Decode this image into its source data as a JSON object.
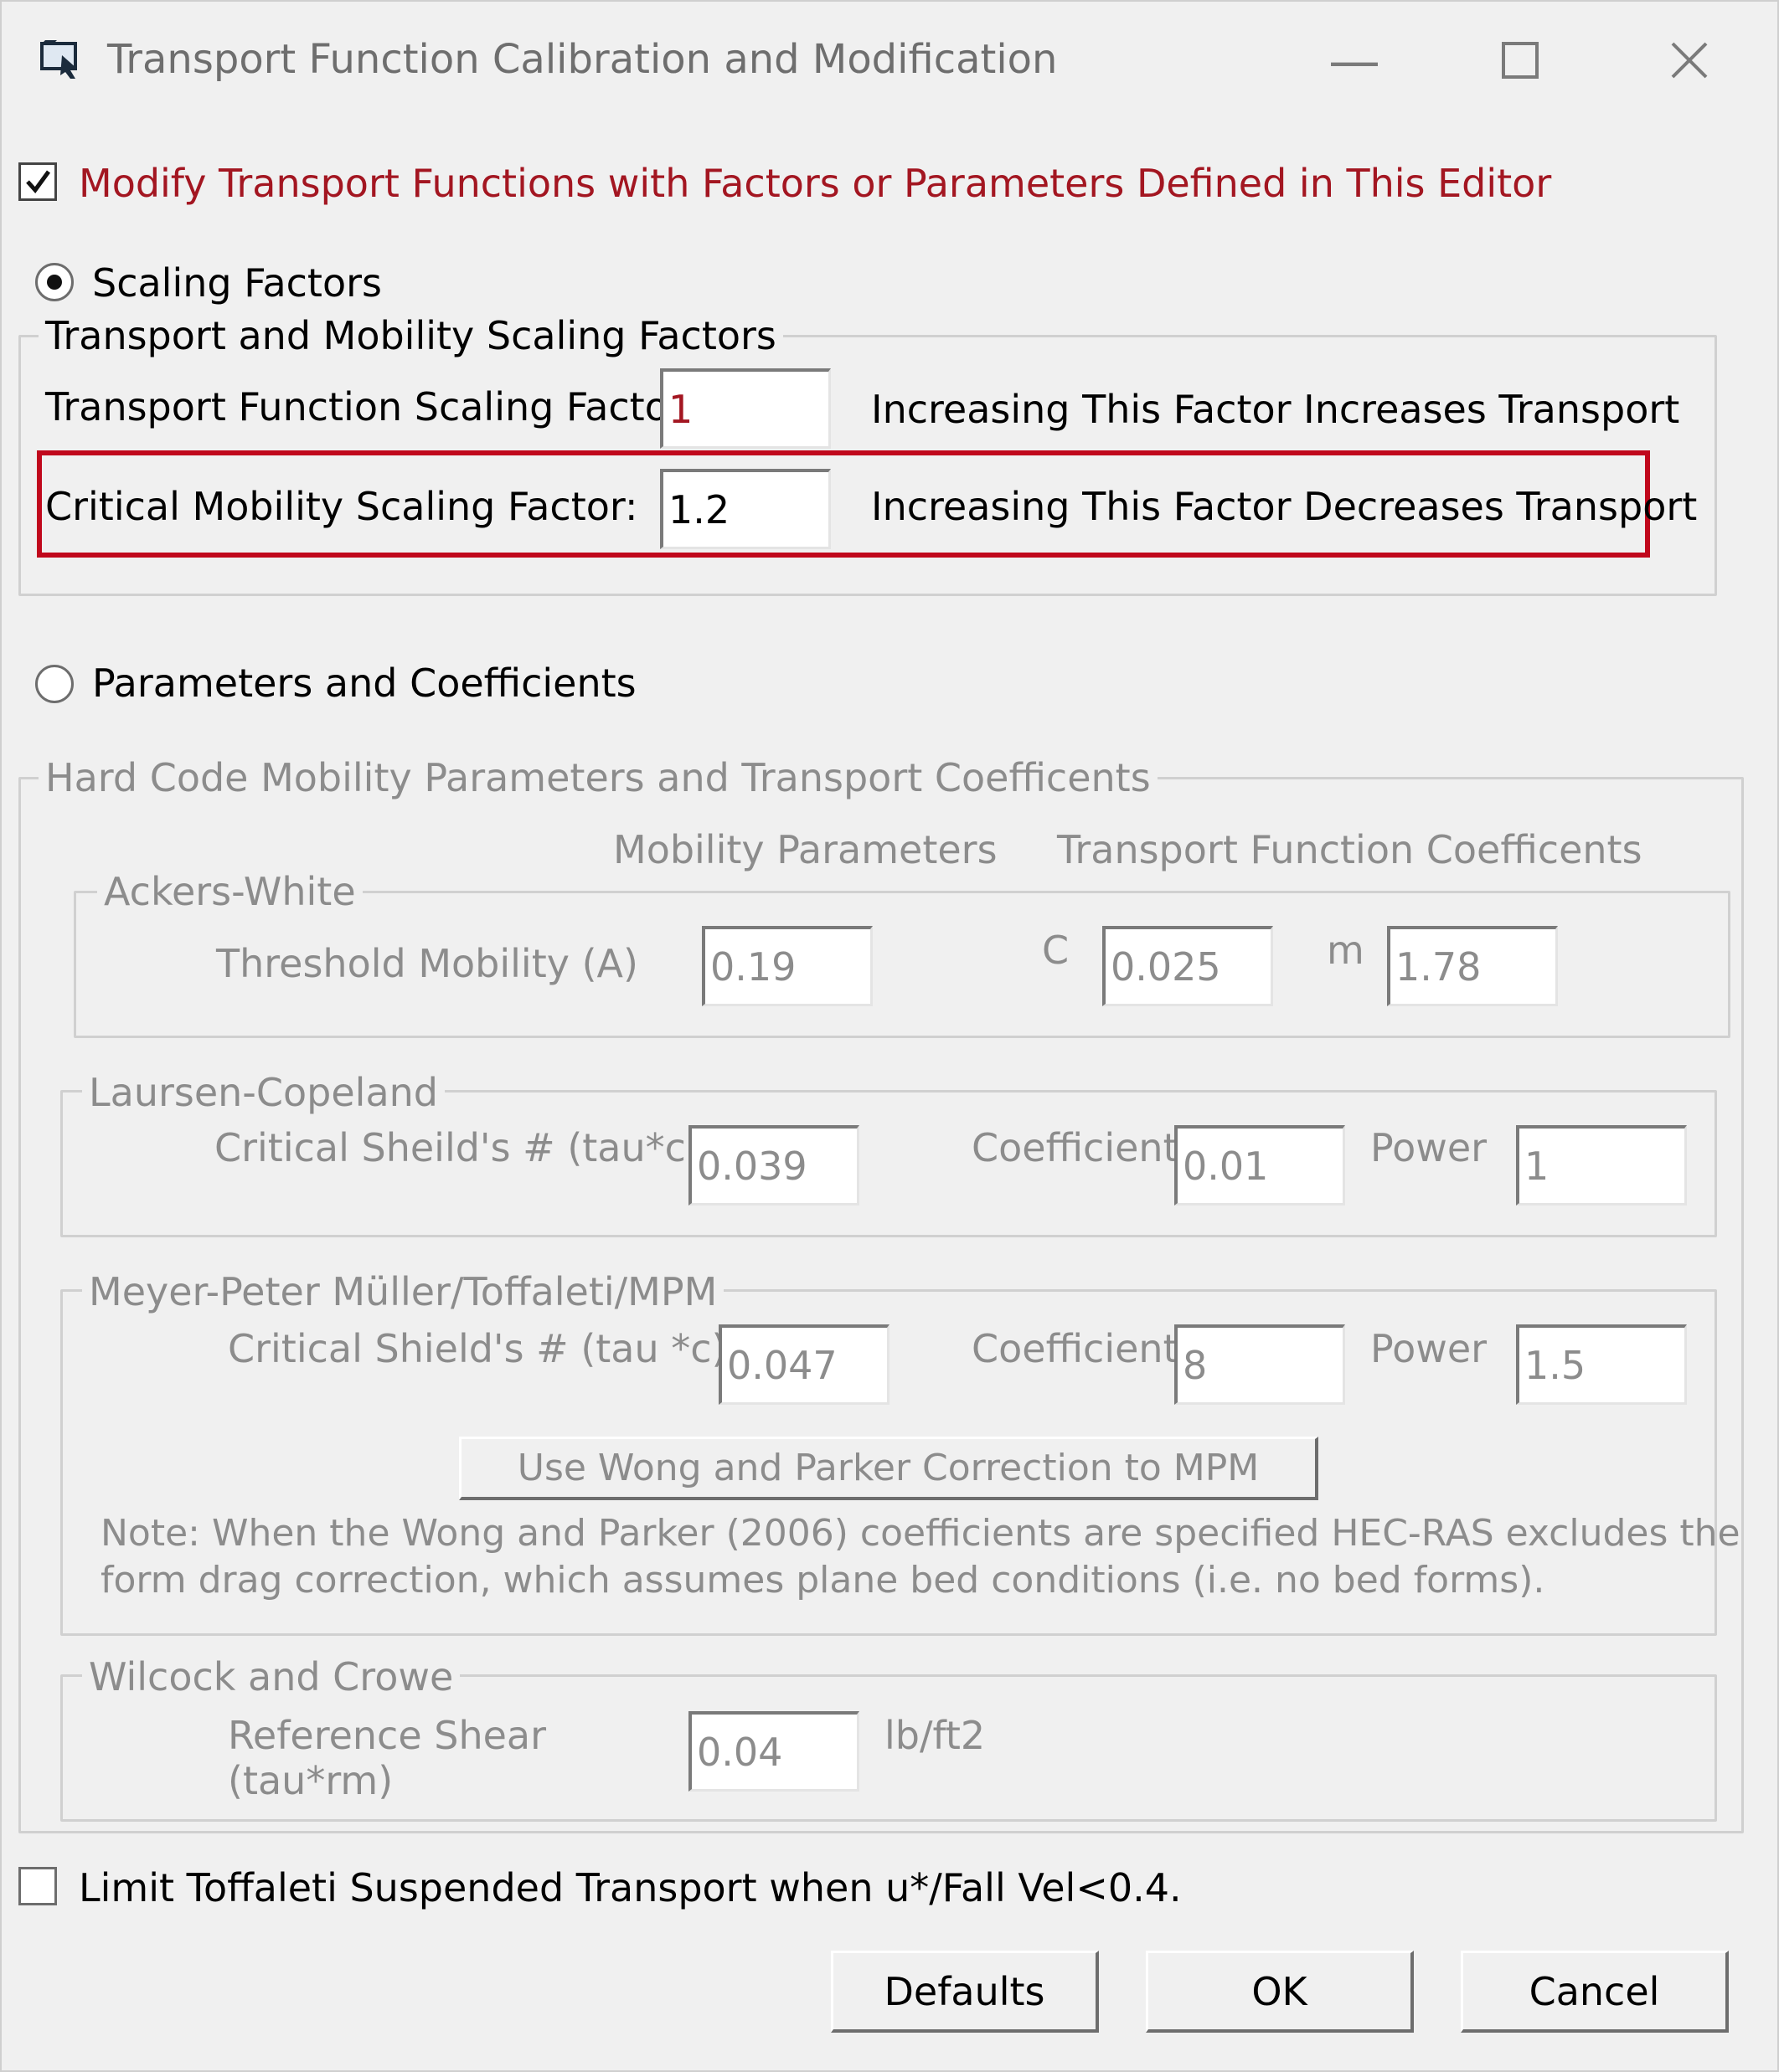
{
  "window": {
    "title": "Transport Function Calibration and Modification"
  },
  "modify_checkbox": {
    "label": "Modify Transport Functions with Factors or Parameters Defined in This Editor",
    "checked": true,
    "color": "#a31621"
  },
  "scaling": {
    "radio_label": "Scaling Factors",
    "selected": true,
    "group_title": "Transport and Mobility Scaling Factors",
    "transport_label": "Transport Function Scaling Factor:",
    "transport_value": "1",
    "transport_note": "Increasing This Factor Increases Transport",
    "critical_label": "Critical Mobility Scaling Factor:",
    "critical_value": "1.2",
    "critical_note": "Increasing This Factor Decreases Transport",
    "highlight_color": "#c0081c"
  },
  "params": {
    "radio_label": "Parameters and Coefficients",
    "selected": false,
    "group_title": "Hard Code Mobility Parameters and Transport Coefficents",
    "col_mobility": "Mobility Parameters",
    "col_coeffs": "Transport Function Coefficents",
    "ackers": {
      "title": "Ackers-White",
      "threshold_label": "Threshold Mobility (A)",
      "threshold_value": "0.19",
      "c_label": "C",
      "c_value": "0.025",
      "m_label": "m",
      "m_value": "1.78"
    },
    "laursen": {
      "title": "Laursen-Copeland",
      "shields_label": "Critical Sheild's # (tau*c)",
      "shields_value": "0.039",
      "coef_label": "Coefficient",
      "coef_value": "0.01",
      "power_label": "Power",
      "power_value": "1"
    },
    "mpm": {
      "title": "Meyer-Peter Müller/Toffaleti/MPM",
      "shields_label": "Critical Shield's # (tau *c)",
      "shields_value": "0.047",
      "coef_label": "Coefficient",
      "coef_value": "8",
      "power_label": "Power",
      "power_value": "1.5",
      "wong_button": "Use Wong and Parker Correction to MPM",
      "note_line1": "Note: When the Wong and Parker (2006) coefficients are specified HEC-RAS excludes the",
      "note_line2": "form drag correction, which assumes plane bed conditions (i.e. no bed forms)."
    },
    "wilcock": {
      "title": "Wilcock and Crowe",
      "ref_label_1": "Reference Shear",
      "ref_label_2": "(tau*rm)",
      "ref_value": "0.04",
      "unit": "lb/ft2"
    }
  },
  "limit_checkbox": {
    "label": "Limit Toffaleti Suspended Transport when u*/Fall Vel<0.4.",
    "checked": false
  },
  "buttons": {
    "defaults": "Defaults",
    "ok": "OK",
    "cancel": "Cancel"
  }
}
